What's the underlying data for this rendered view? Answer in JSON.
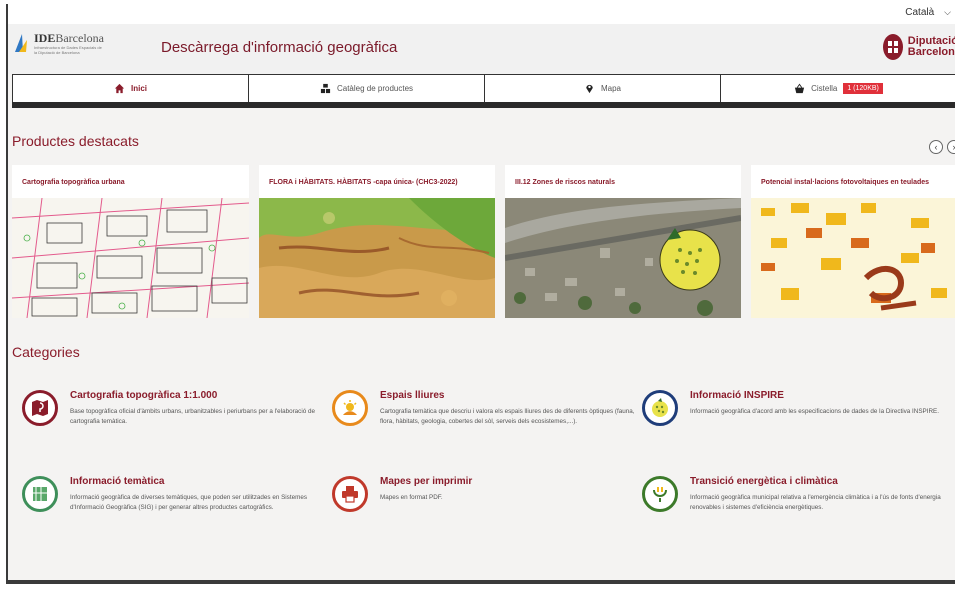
{
  "language": {
    "selected": "Català"
  },
  "header": {
    "logo_brand": "IDE",
    "logo_brand_rest": "Barcelona",
    "logo_subtitle": "Infraestructura de Dades Espacials de la Diputació de Barcelona",
    "title": "Descàrrega d'informació geogràfica",
    "org_line1": "Diputació",
    "org_line2": "Barcelona"
  },
  "nav": [
    {
      "label": "Inici",
      "icon": "home-icon"
    },
    {
      "label": "Catàleg de productes",
      "icon": "catalog-icon"
    },
    {
      "label": "Mapa",
      "icon": "map-pin-icon"
    },
    {
      "label": "Cistella",
      "icon": "basket-icon",
      "badge": "1 (120KB)"
    }
  ],
  "featured": {
    "title": "Productes destacats",
    "prev_symbol": "‹",
    "next_symbol": "›",
    "products": [
      {
        "title": "Cartografia topogràfica urbana"
      },
      {
        "title": "FLORA i HÀBITATS. HÀBITATS -capa única- (CHC3-2022)"
      },
      {
        "title": "III.12 Zones de riscos naturals"
      },
      {
        "title": "Potencial instal·lacions fotovoltaiques en teulades"
      }
    ]
  },
  "categories": {
    "title": "Categories",
    "items": [
      {
        "title": "Cartografia topogràfica 1:1.000",
        "desc": "Base topogràfica oficial d'àmbits urbans, urbanitzables i periurbans per a l'elaboració de cartografia temàtica.",
        "color": "#8a1c2b",
        "icon": "topographic-map-icon"
      },
      {
        "title": "Espais lliures",
        "desc": "Cartografia temàtica que descriu i valora els espais lliures des de diferents òptiques (fauna, flora, hàbitats, geologia, cobertes del sòl, serveis dels ecosistemes,...).",
        "color": "#e88a1c",
        "icon": "sun-landscape-icon"
      },
      {
        "title": "Informació INSPIRE",
        "desc": "Informació geogràfica d'acord amb les especificacions de dades de la Directiva INSPIRE.",
        "color": "#1f3d7a",
        "icon": "inspire-globe-icon"
      },
      {
        "title": "Informació temàtica",
        "desc": "Informació geogràfica de diverses temàtiques, que poden ser utilitzades en Sistemes d'Informació Geogràfica (SIG) i per generar altres productes cartogràfics.",
        "color": "#3e8f5a",
        "icon": "thematic-map-icon"
      },
      {
        "title": "Mapes per imprimir",
        "desc": "Mapes en format PDF.",
        "color": "#c0392b",
        "icon": "printer-icon"
      },
      {
        "title": "Transició energètica i climàtica",
        "desc": "Informació geogràfica municipal relativa a l'emergència climàtica i a l'ús de fonts d'energia renovables i sistemes d'eficiència energètiques.",
        "color": "#3c7a2a",
        "icon": "energy-plug-icon"
      }
    ]
  }
}
